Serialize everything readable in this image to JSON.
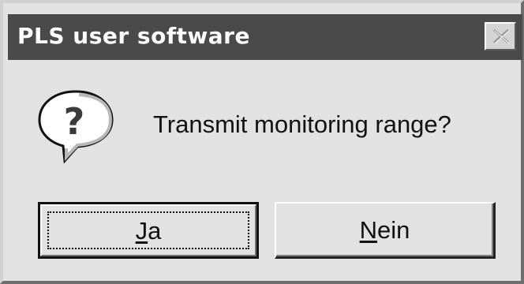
{
  "window": {
    "title": "PLS user software",
    "close_icon": "close-icon"
  },
  "message": {
    "icon": "question-icon",
    "text": "Transmit monitoring range?"
  },
  "buttons": {
    "yes": {
      "mnemonic": "J",
      "rest": "a",
      "label": "Ja"
    },
    "no": {
      "mnemonic": "N",
      "rest": "ein",
      "label": "Nein"
    }
  },
  "colors": {
    "titlebar": "#4a4a4a",
    "dialog_background": "#e2e2e2",
    "title_text": "#ffffff"
  }
}
